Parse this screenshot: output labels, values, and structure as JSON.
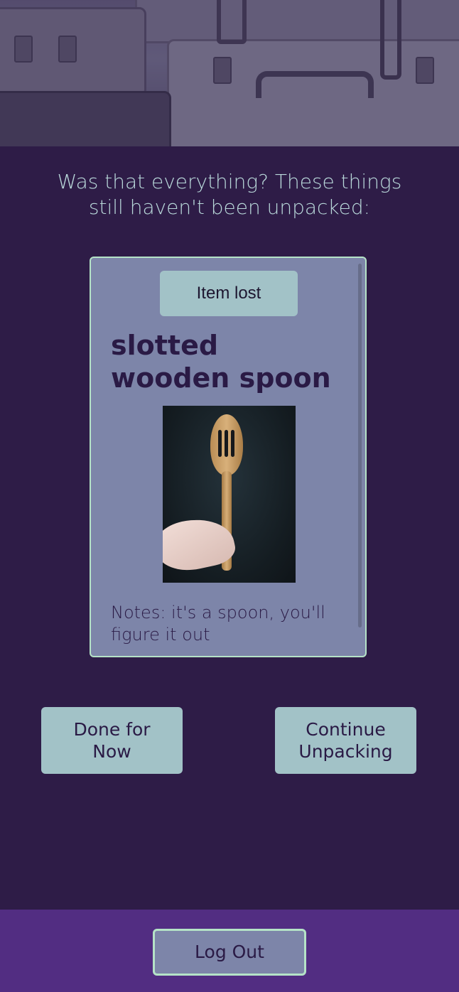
{
  "prompt": {
    "line1": "Was that everything? These things",
    "line2": "still haven't been unpacked:"
  },
  "item": {
    "status_button": "Item lost",
    "name": "slotted wooden spoon",
    "photo_icon": "wooden-spoon-photo",
    "notes": "Notes: it's a spoon, you'll figure it out"
  },
  "actions": {
    "done_line1": "Done for",
    "done_line2": "Now",
    "continue_line1": "Continue",
    "continue_line2": "Unpacking"
  },
  "footer": {
    "logout": "Log Out"
  },
  "colors": {
    "background": "#2e1c47",
    "card": "#7d85a9",
    "button": "#a2c2c7",
    "accent_border": "#b5e3c7",
    "footer": "#522d82",
    "text_light": "#b9d8da",
    "text_dark": "#2a1a45"
  }
}
